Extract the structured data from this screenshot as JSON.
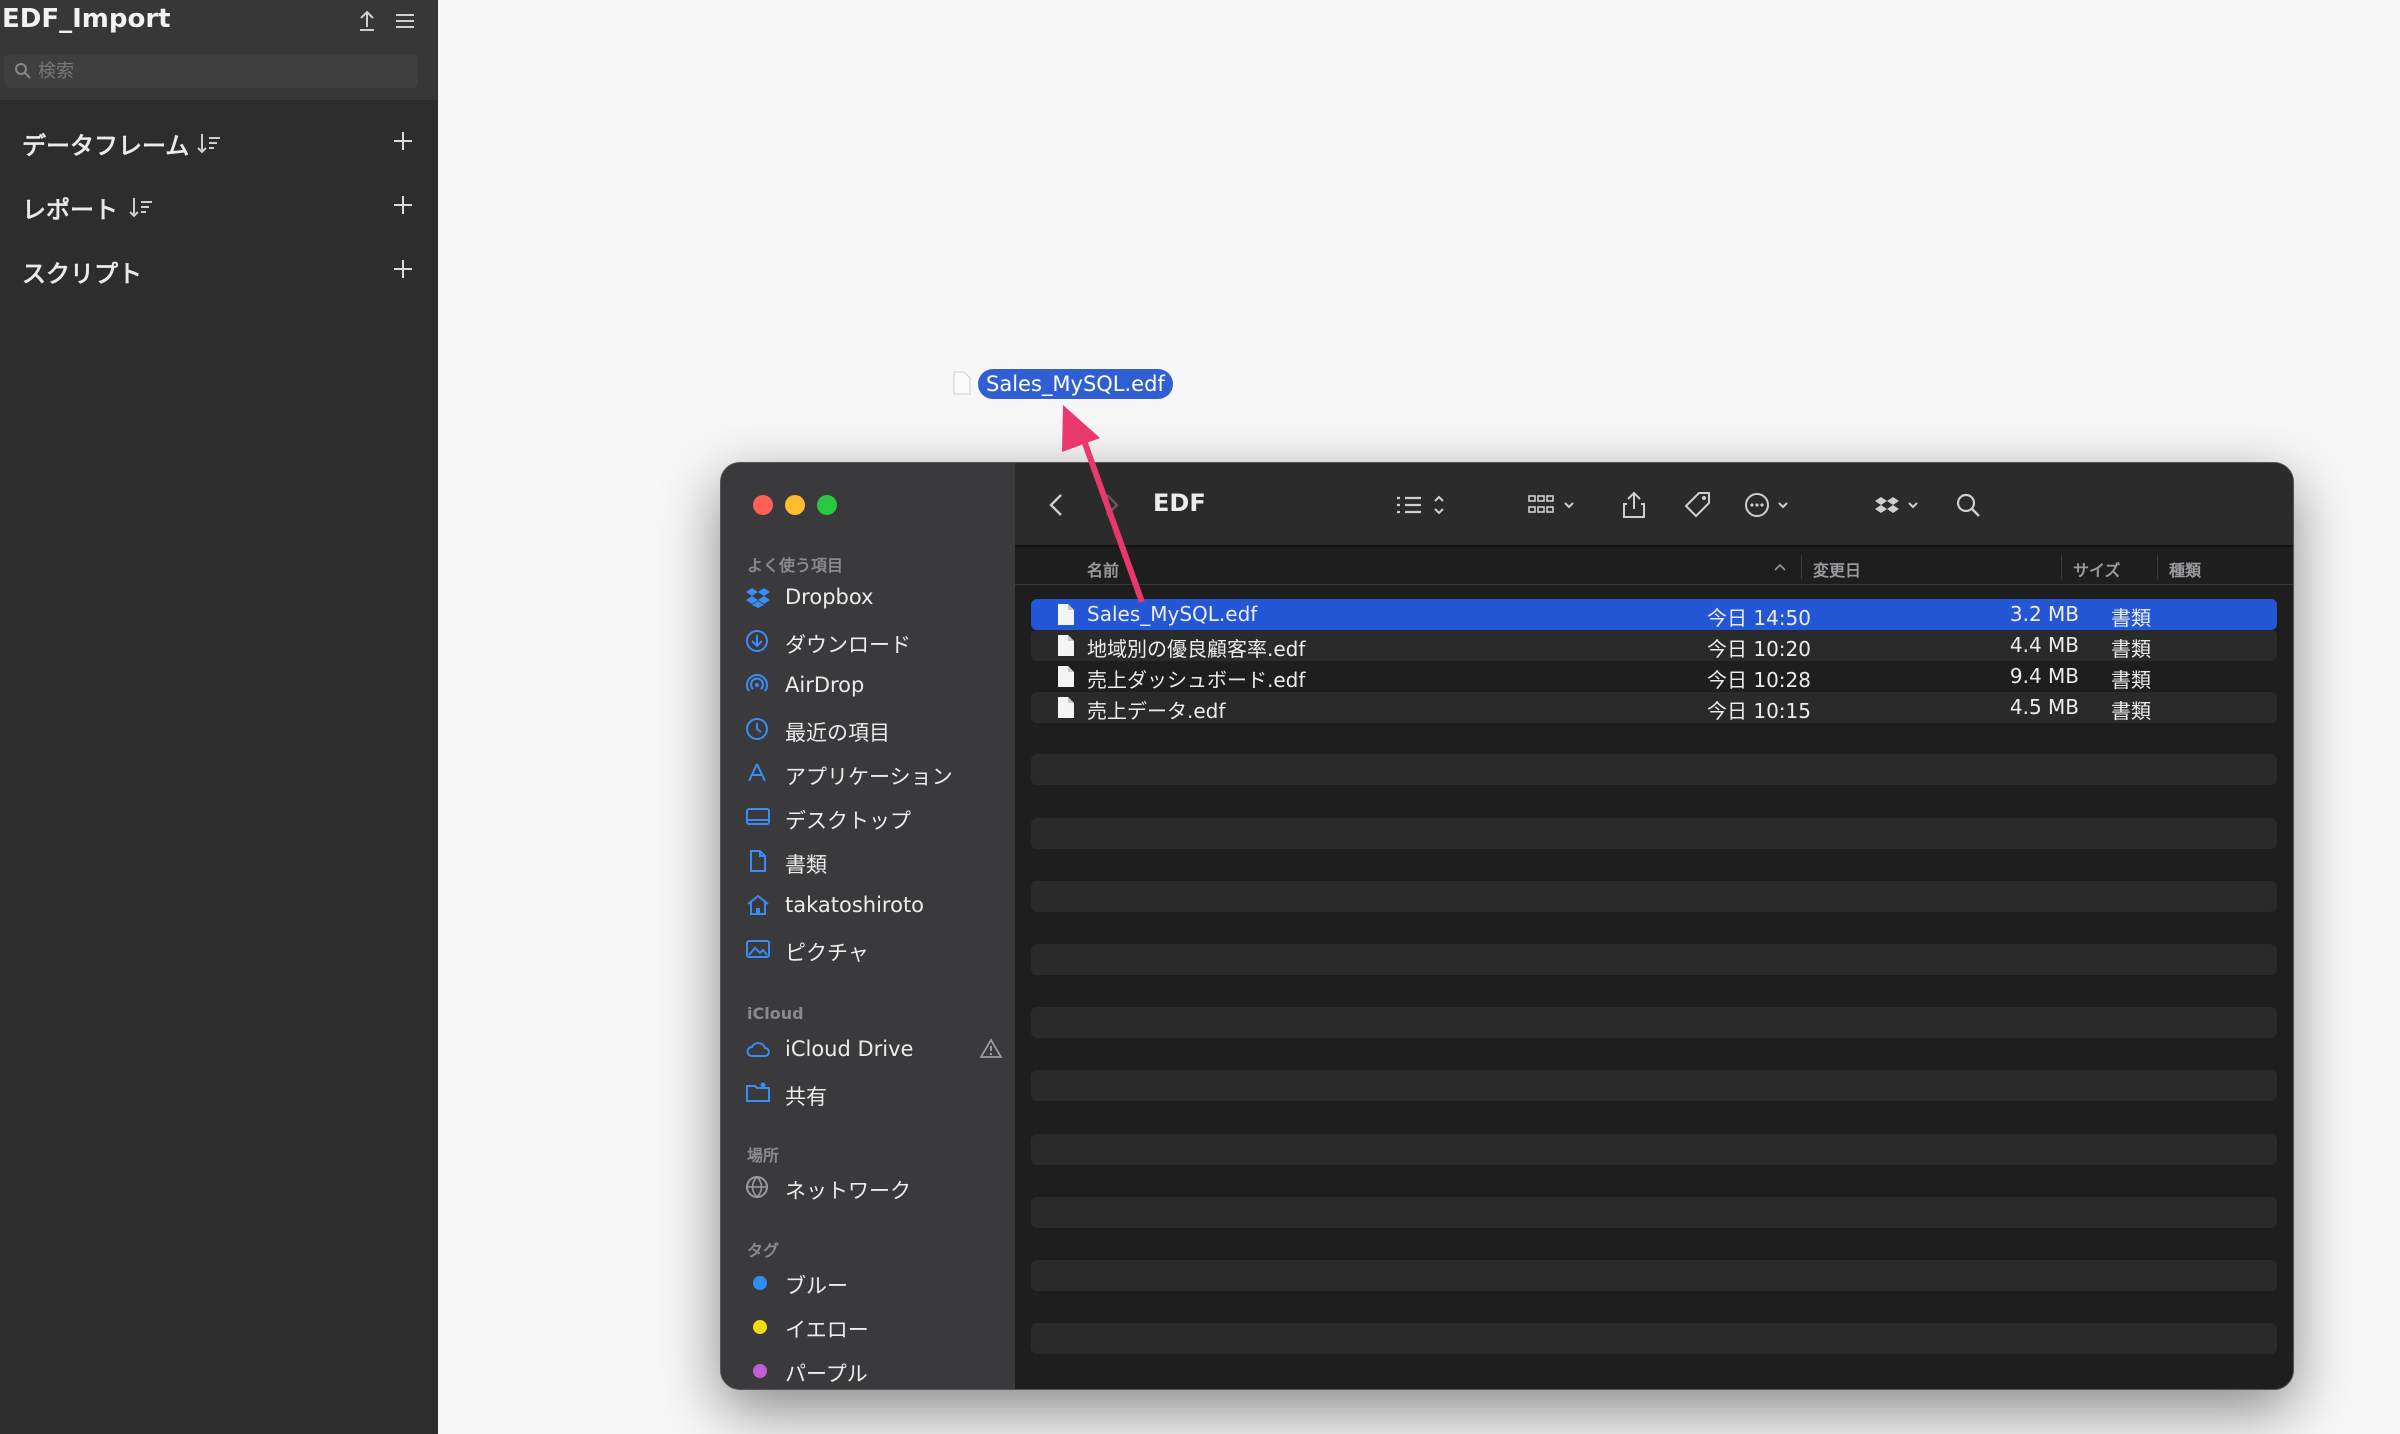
{
  "app": {
    "title": "EDF_Import",
    "search_placeholder": "検索",
    "sections": [
      {
        "label": "データフレーム"
      },
      {
        "label": "レポート"
      },
      {
        "label": "スクリプト"
      }
    ]
  },
  "drag": {
    "filename": "Sales_MySQL.edf",
    "arrow_color": "#e8386e"
  },
  "finder": {
    "title": "EDF",
    "sidebar": {
      "favorites_header": "よく使う項目",
      "favorites": [
        {
          "label": "Dropbox",
          "icon": "dropbox-icon"
        },
        {
          "label": "ダウンロード",
          "icon": "download-icon"
        },
        {
          "label": "AirDrop",
          "icon": "airdrop-icon"
        },
        {
          "label": "最近の項目",
          "icon": "clock-icon"
        },
        {
          "label": "アプリケーション",
          "icon": "applications-icon"
        },
        {
          "label": "デスクトップ",
          "icon": "desktop-icon"
        },
        {
          "label": "書類",
          "icon": "document-icon"
        },
        {
          "label": "takatoshiroto",
          "icon": "home-icon"
        },
        {
          "label": "ピクチャ",
          "icon": "pictures-icon"
        }
      ],
      "icloud_header": "iCloud",
      "icloud": [
        {
          "label": "iCloud Drive",
          "icon": "cloud-icon"
        },
        {
          "label": "共有",
          "icon": "shared-folder-icon"
        }
      ],
      "locations_header": "場所",
      "locations": [
        {
          "label": "ネットワーク",
          "icon": "globe-icon"
        }
      ],
      "tags_header": "タグ",
      "tags": [
        {
          "label": "ブルー",
          "color": "#2f8ff0"
        },
        {
          "label": "イエロー",
          "color": "#f5d90a"
        },
        {
          "label": "パープル",
          "color": "#c05ed8"
        }
      ]
    },
    "columns": {
      "name": "名前",
      "date": "変更日",
      "size": "サイズ",
      "kind": "種類"
    },
    "files": [
      {
        "name": "Sales_MySQL.edf",
        "date": "今日 14:50",
        "size": "3.2 MB",
        "kind": "書類",
        "selected": true
      },
      {
        "name": "地域別の優良顧客率.edf",
        "date": "今日 10:20",
        "size": "4.4 MB",
        "kind": "書類",
        "selected": false
      },
      {
        "name": "売上ダッシュボード.edf",
        "date": "今日 10:28",
        "size": "9.4 MB",
        "kind": "書類",
        "selected": false
      },
      {
        "name": "売上データ.edf",
        "date": "今日 10:15",
        "size": "4.5 MB",
        "kind": "書類",
        "selected": false
      }
    ]
  }
}
